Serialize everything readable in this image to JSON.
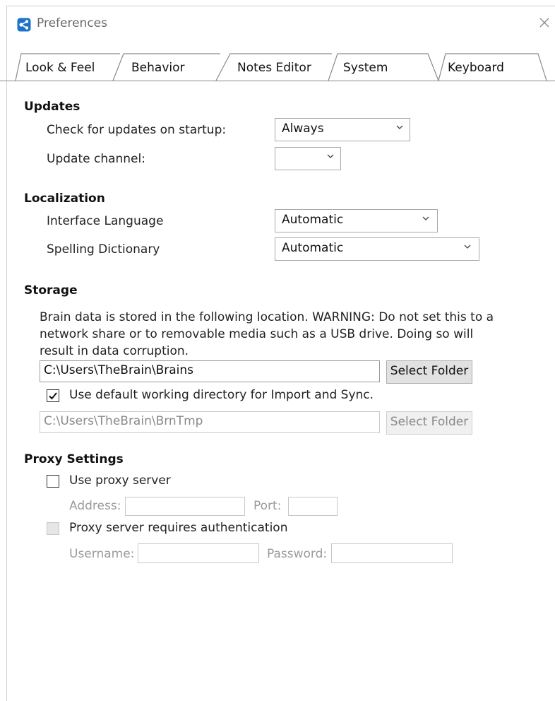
{
  "window": {
    "title": "Preferences",
    "close_glyph": "×"
  },
  "tabs": [
    {
      "label": "Look & Feel",
      "selected": false
    },
    {
      "label": "Behavior",
      "selected": false
    },
    {
      "label": "Notes Editor",
      "selected": false
    },
    {
      "label": "System",
      "selected": true
    },
    {
      "label": "Keyboard",
      "selected": false
    }
  ],
  "updates": {
    "title": "Updates",
    "check_label": "Check for updates on startup:",
    "check_value": "Always",
    "channel_label": "Update channel:",
    "channel_value": ""
  },
  "localization": {
    "title": "Localization",
    "language_label": "Interface Language",
    "language_value": "Automatic",
    "dictionary_label": "Spelling Dictionary",
    "dictionary_value": "Automatic"
  },
  "storage": {
    "title": "Storage",
    "description_lines": [
      "Brain data is stored in the following location. WARNING: Do not set this to a",
      "network share or to removable media such as a USB drive. Doing so will",
      "result in data corruption."
    ],
    "path_value": "C:\\Users\\TheBrain\\Brains",
    "select_folder_label": "Select Folder",
    "use_default_label": "Use default working directory for Import and Sync.",
    "use_default_checked": true,
    "working_path_value": "C:\\Users\\TheBrain\\BrnTmp",
    "working_select_folder_label": "Select Folder"
  },
  "proxy": {
    "title": "Proxy Settings",
    "use_proxy_label": "Use proxy server",
    "use_proxy_checked": false,
    "address_label": "Address:",
    "address_value": "",
    "port_label": "Port:",
    "port_value": "",
    "auth_label": "Proxy server requires authentication",
    "auth_checked": false,
    "username_label": "Username:",
    "username_value": "",
    "password_label": "Password:",
    "password_value": ""
  },
  "icons": {
    "app": "brain-app-icon",
    "close": "close-icon",
    "dropdown": "chevron-down-icon",
    "check": "checkmark-icon"
  },
  "colors": {
    "app_icon_blue": "#1e73c8",
    "disabled_text": "#8a8a8a"
  }
}
